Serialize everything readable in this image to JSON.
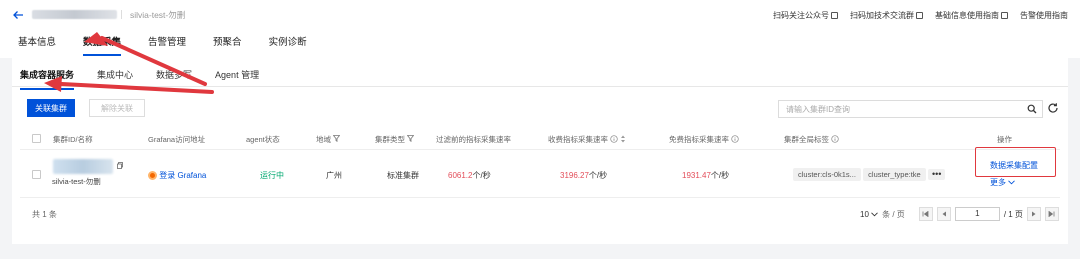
{
  "header": {
    "instance_name": "silvia-test-勿删",
    "links": [
      {
        "label": "扫码关注公众号"
      },
      {
        "label": "扫码加技术交流群"
      },
      {
        "label": "基础信息使用指南"
      },
      {
        "label": "告警使用指南"
      }
    ]
  },
  "main_tabs": [
    {
      "label": "基本信息"
    },
    {
      "label": "数据采集"
    },
    {
      "label": "告警管理"
    },
    {
      "label": "预聚合"
    },
    {
      "label": "实例诊断"
    }
  ],
  "sub_tabs": [
    {
      "label": "集成容器服务"
    },
    {
      "label": "集成中心"
    },
    {
      "label": "数据多写"
    },
    {
      "label": "Agent 管理"
    }
  ],
  "toolbar": {
    "associate_button": "关联集群",
    "disassociate_button": "解除关联",
    "search_placeholder": "请输入集群ID查询"
  },
  "table": {
    "headers": {
      "cluster": "集群ID/名称",
      "grafana": "Grafana访问地址",
      "agent": "agent状态",
      "region": "地域",
      "type": "集群类型",
      "pre_filter_rate": "过滤前的指标采集速率",
      "billed_rate": "收费指标采集速率",
      "free_rate": "免费指标采集速率",
      "tags": "集群全局标签",
      "actions": "操作"
    },
    "rows": [
      {
        "cluster_name": "silvia-test-勿删",
        "grafana_link": "登录 Grafana",
        "agent_status": "运行中",
        "region": "广州",
        "cluster_type": "标准集群",
        "pre_filter_rate_value": "6061.2",
        "pre_filter_rate_unit": "个/秒",
        "billed_rate_value": "3196.27",
        "billed_rate_unit": "个/秒",
        "free_rate_value": "1931.47",
        "free_rate_unit": "个/秒",
        "tags": [
          "cluster:cls-0k1s...",
          "cluster_type:tke"
        ],
        "tags_more": "•••",
        "action_config": "数据采集配置",
        "action_more": "更多"
      }
    ]
  },
  "footer": {
    "total": "共 1 条",
    "page_size": "10",
    "page_size_unit": "条 / 页",
    "current_page": "1",
    "total_pages": "/ 1 页"
  },
  "colors": {
    "primary": "#0052d9",
    "status_running": "#00a870",
    "rate_red": "#e34d59",
    "annotation_red": "#e0383e"
  }
}
